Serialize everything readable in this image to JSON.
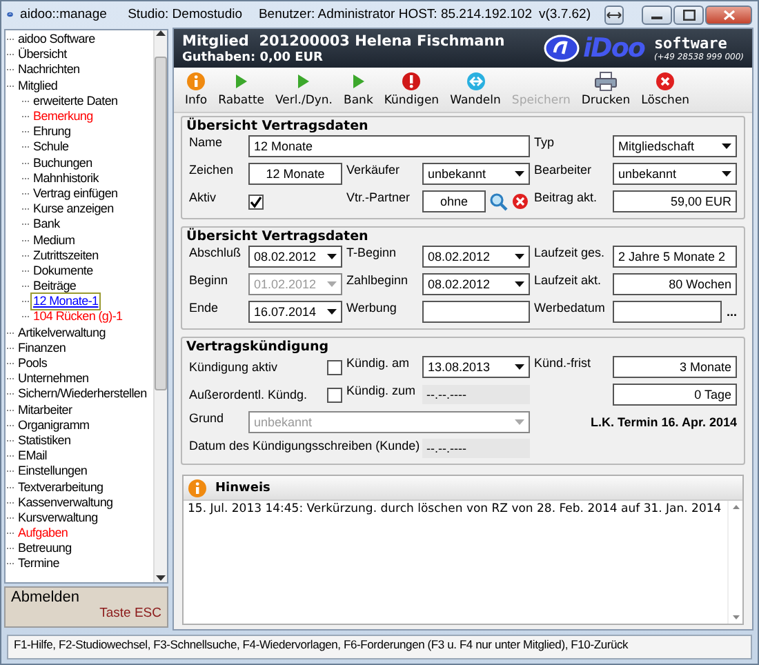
{
  "window": {
    "title": "aidoo::manage",
    "studio": "Studio: Demostudio",
    "user": "Benutzer: Administrator HOST: 85.214.192.102",
    "version": "v(3.7.62)"
  },
  "tree": {
    "items": [
      {
        "label": "aidoo Software",
        "color": "#000000",
        "selected": false
      },
      {
        "label": "Übersicht",
        "color": "#000000",
        "selected": false
      },
      {
        "label": "Nachrichten",
        "color": "#000000",
        "selected": false
      },
      {
        "label": "Mitglied",
        "color": "#000000",
        "selected": false,
        "children": [
          {
            "label": "erweiterte Daten",
            "color": "#000000",
            "selected": false
          },
          {
            "label": "Bemerkung",
            "color": "#ff0000",
            "selected": false
          },
          {
            "label": "Ehrung",
            "color": "#000000",
            "selected": false
          },
          {
            "label": "Schule",
            "color": "#000000",
            "selected": false
          },
          {
            "label": "Buchungen",
            "color": "#000000",
            "selected": false
          },
          {
            "label": "Mahnhistorik",
            "color": "#000000",
            "selected": false
          },
          {
            "label": "Vertrag einfügen",
            "color": "#000000",
            "selected": false
          },
          {
            "label": "Kurse anzeigen",
            "color": "#000000",
            "selected": false
          },
          {
            "label": "Bank",
            "color": "#000000",
            "selected": false
          },
          {
            "label": "Medium",
            "color": "#000000",
            "selected": false
          },
          {
            "label": "Zutrittszeiten",
            "color": "#000000",
            "selected": false
          },
          {
            "label": "Dokumente",
            "color": "#000000",
            "selected": false
          },
          {
            "label": "Beiträge",
            "color": "#000000",
            "selected": false
          },
          {
            "label": "12 Monate-1",
            "color": "#0000ff",
            "selected": true
          },
          {
            "label": "104 Rücken (g)-1",
            "color": "#ff0000",
            "selected": false
          }
        ]
      },
      {
        "label": "Artikelverwaltung",
        "color": "#000000",
        "selected": false
      },
      {
        "label": "Finanzen",
        "color": "#000000",
        "selected": false
      },
      {
        "label": "Pools",
        "color": "#000000",
        "selected": false
      },
      {
        "label": "Unternehmen",
        "color": "#000000",
        "selected": false
      },
      {
        "label": "Sichern/Wiederherstellen",
        "color": "#000000",
        "selected": false
      },
      {
        "label": "Mitarbeiter",
        "color": "#000000",
        "selected": false
      },
      {
        "label": "Organigramm",
        "color": "#000000",
        "selected": false
      },
      {
        "label": "Statistiken",
        "color": "#000000",
        "selected": false
      },
      {
        "label": "EMail",
        "color": "#000000",
        "selected": false
      },
      {
        "label": "Einstellungen",
        "color": "#000000",
        "selected": false
      },
      {
        "label": "Textverarbeitung",
        "color": "#000000",
        "selected": false
      },
      {
        "label": "Kassenverwaltung",
        "color": "#000000",
        "selected": false
      },
      {
        "label": "Kursverwaltung",
        "color": "#000000",
        "selected": false
      },
      {
        "label": "Aufgaben",
        "color": "#ff0000",
        "selected": false
      },
      {
        "label": "Betreuung",
        "color": "#000000",
        "selected": false
      },
      {
        "label": "Termine",
        "color": "#000000",
        "selected": false
      }
    ]
  },
  "logout": {
    "label": "Abmelden",
    "hint": "Taste ESC"
  },
  "header": {
    "kind": "Mitglied",
    "member": "201200003 Helena Fischmann",
    "balance": "Guthaben: 0,00 EUR",
    "logo": "iDoo",
    "logo_word": "software",
    "phone": "(+49 28538 999 000)"
  },
  "toolbar": [
    {
      "label": "Info",
      "kind": "info",
      "disabled": false
    },
    {
      "label": "Rabatte",
      "kind": "action",
      "disabled": false
    },
    {
      "label": "Verl./Dyn.",
      "kind": "action",
      "disabled": false
    },
    {
      "label": "Bank",
      "kind": "action",
      "disabled": false
    },
    {
      "label": "Kündigen",
      "kind": "cancel",
      "disabled": false
    },
    {
      "label": "Wandeln",
      "kind": "convert",
      "disabled": false
    },
    {
      "label": "Speichern",
      "kind": "save",
      "disabled": true
    },
    {
      "label": "Drucken",
      "kind": "print",
      "disabled": false
    },
    {
      "label": "Löschen",
      "kind": "delete",
      "disabled": false
    }
  ],
  "sections": [
    {
      "title": "Übersicht Vertragsdaten",
      "items": [
        {
          "kind": "label",
          "text": "Name"
        },
        {
          "kind": "text-wide",
          "value": "12 Monate"
        },
        {
          "kind": "label",
          "text": "Typ"
        },
        {
          "kind": "select",
          "value": "Mitgliedschaft",
          "disabled": false
        },
        {
          "kind": "label",
          "text": "Zeichen"
        },
        {
          "kind": "text-center",
          "value": "12 Monate"
        },
        {
          "kind": "label",
          "text": "Verkäufer"
        },
        {
          "kind": "select",
          "value": "unbekannt",
          "disabled": false
        },
        {
          "kind": "label",
          "text": "Bearbeiter"
        },
        {
          "kind": "select",
          "value": "unbekannt",
          "disabled": false
        },
        {
          "kind": "label",
          "text": "Aktiv"
        },
        {
          "kind": "checkbox",
          "checked": true
        },
        {
          "kind": "label",
          "text": "Vtr.-Partner"
        },
        {
          "kind": "partner",
          "value": "ohne"
        },
        {
          "kind": "label",
          "text": "Beitrag akt."
        },
        {
          "kind": "text-right",
          "value": "59,00 EUR"
        }
      ]
    },
    {
      "title": "Übersicht Vertragsdaten",
      "items": [
        {
          "kind": "label",
          "text": "Abschluß"
        },
        {
          "kind": "date",
          "value": "08.02.2012",
          "disabled": false
        },
        {
          "kind": "label",
          "text": "T-Beginn"
        },
        {
          "kind": "date",
          "value": "08.02.2012",
          "disabled": false
        },
        {
          "kind": "label",
          "text": "Laufzeit ges."
        },
        {
          "kind": "text",
          "value": "2 Jahre 5 Monate 2"
        },
        {
          "kind": "label",
          "text": "Beginn"
        },
        {
          "kind": "date",
          "value": "01.02.2012",
          "disabled": true
        },
        {
          "kind": "label",
          "text": "Zahlbeginn"
        },
        {
          "kind": "date",
          "value": "08.02.2012",
          "disabled": false
        },
        {
          "kind": "label",
          "text": "Laufzeit akt."
        },
        {
          "kind": "text-right",
          "value": "80 Wochen"
        },
        {
          "kind": "label",
          "text": "Ende"
        },
        {
          "kind": "date",
          "value": "16.07.2014",
          "disabled": false
        },
        {
          "kind": "label",
          "text": "Werbung"
        },
        {
          "kind": "text"
        },
        {
          "kind": "label",
          "text": "Werbedatum"
        },
        {
          "kind": "text-more",
          "button": "..."
        }
      ]
    },
    {
      "title": "Vertragskündigung",
      "items": [
        {
          "kind": "check-row",
          "text": "Kündigung aktiv",
          "checked": false
        },
        {
          "kind": "label",
          "text": "Kündig. am"
        },
        {
          "kind": "date",
          "value": "13.08.2013",
          "disabled": false
        },
        {
          "kind": "label",
          "text": "Künd.-frist"
        },
        {
          "kind": "text-right",
          "value": "3 Monate"
        },
        {
          "kind": "check-row",
          "text": "Außerordentl. Kündg.",
          "checked": false
        },
        {
          "kind": "label",
          "text": "Kündig. zum"
        },
        {
          "kind": "readonly",
          "value": "--.--.----"
        },
        {
          "kind": "blank"
        },
        {
          "kind": "text-right",
          "value": "0 Tage"
        },
        {
          "kind": "label",
          "text": "Grund"
        },
        {
          "kind": "select-wide",
          "value": "unbekannt",
          "disabled": true
        },
        {
          "kind": "note-wide",
          "text": "L.K. Termin 16. Apr. 2014"
        },
        {
          "kind": "label-wide",
          "text": "Datum des Kündigungsschreiben (Kunde)"
        },
        {
          "kind": "readonly",
          "value": "--.--.----"
        }
      ]
    }
  ],
  "notice": {
    "title": "Hinweis",
    "text": "15. Jul. 2013 14:45: Verkürzung. durch löschen von RZ  von 28. Feb. 2014 auf 31. Jan. 2014"
  },
  "status_bar": "F1-Hilfe, F2-Studiowechsel, F3-Schnellsuche, F4-Wiedervorlagen, F6-Forderungen (F3 u. F4 nur unter Mitglied), F10-Zurück"
}
